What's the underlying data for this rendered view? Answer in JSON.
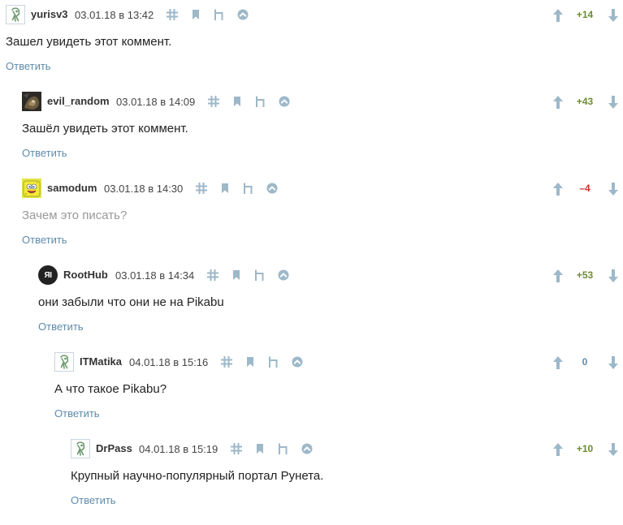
{
  "colors": {
    "positive_score": "#6d8c2d",
    "negative_score": "#cf3123",
    "neutral_score": "#5e8bab",
    "link": "#5e8bab",
    "icon": "#9db8c9",
    "muted_text": "#999999"
  },
  "icons": {
    "permalink": "hash-icon",
    "bookmark": "bookmark-icon",
    "parent": "parent-link-icon",
    "up_to_parent": "arrow-up-circle-icon",
    "vote_up": "arrow-up-icon",
    "vote_down": "arrow-down-icon"
  },
  "comments": [
    {
      "username": "yurisv3",
      "timestamp": "03.01.18 в 13:42",
      "text": "Зашел увидеть этот коммент.",
      "score": "+14",
      "score_type": "pos",
      "reply_label": "Ответить",
      "avatar": "default-robot"
    },
    {
      "username": "evil_random",
      "timestamp": "03.01.18 в 14:09",
      "text": "Зашёл увидеть этот коммент.",
      "score": "+43",
      "score_type": "pos",
      "reply_label": "Ответить",
      "avatar": "photo"
    },
    {
      "username": "samodum",
      "timestamp": "03.01.18 в 14:30",
      "text": "Зачем это писать?",
      "score": "–4",
      "score_type": "neg",
      "text_muted": true,
      "reply_label": "Ответить",
      "avatar": "sponge"
    },
    {
      "username": "RootHub",
      "timestamp": "03.01.18 в 14:34",
      "text": "они забыли что они не на Pikabu",
      "score": "+53",
      "score_type": "pos",
      "reply_label": "Ответить",
      "avatar": "logo-ri",
      "avatar_text": "ЯI"
    },
    {
      "username": "ITMatika",
      "timestamp": "04.01.18 в 15:16",
      "text": "А что такое Pikabu?",
      "score": "0",
      "score_type": "zero",
      "reply_label": "Ответить",
      "avatar": "default-robot"
    },
    {
      "username": "DrPass",
      "timestamp": "04.01.18 в 15:19",
      "text": "Крупный научно-популярный портал Рунета.",
      "score": "+10",
      "score_type": "pos",
      "reply_label": "Ответить",
      "avatar": "default-robot"
    }
  ]
}
